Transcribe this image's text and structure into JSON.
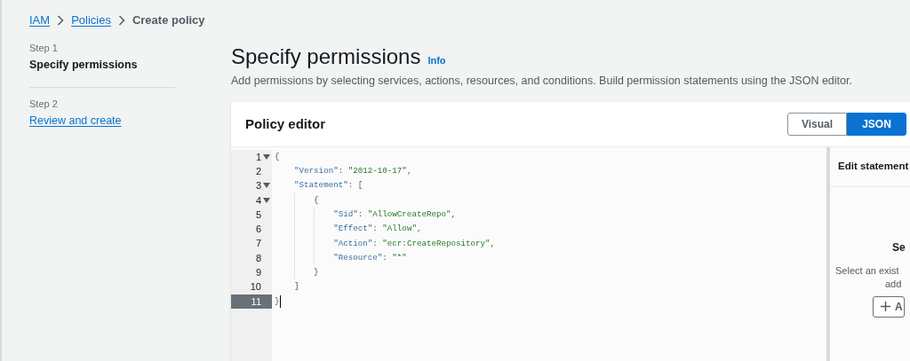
{
  "breadcrumb": [
    {
      "label": "IAM",
      "link": true
    },
    {
      "label": "Policies",
      "link": true
    },
    {
      "label": "Create policy",
      "link": false
    }
  ],
  "steps": [
    {
      "step": "Step 1",
      "title": "Specify permissions",
      "selected": true
    },
    {
      "step": "Step 2",
      "title": "Review and create",
      "selected": false
    }
  ],
  "heading": {
    "title": "Specify permissions",
    "info": "Info",
    "description": "Add permissions by selecting services, actions, resources, and conditions. Build permission statements using the JSON editor."
  },
  "policy_editor": {
    "title": "Policy editor",
    "modes": [
      {
        "label": "Visual",
        "selected": false
      },
      {
        "label": "JSON",
        "selected": true
      }
    ],
    "lines": [
      {
        "number": "1",
        "foldable": true,
        "selected": false,
        "tokens": [
          {
            "kind": "punct",
            "text": "{"
          }
        ]
      },
      {
        "number": "2",
        "foldable": false,
        "selected": false,
        "tokens": [
          {
            "kind": "key",
            "text": "    \"Version\""
          },
          {
            "kind": "punct",
            "text": ": "
          },
          {
            "kind": "string",
            "text": "\"2012-10-17\""
          },
          {
            "kind": "punct",
            "text": ","
          }
        ]
      },
      {
        "number": "3",
        "foldable": true,
        "selected": false,
        "tokens": [
          {
            "kind": "key",
            "text": "    \"Statement\""
          },
          {
            "kind": "punct",
            "text": ": ["
          }
        ]
      },
      {
        "number": "4",
        "foldable": true,
        "selected": false,
        "tokens": [
          {
            "kind": "punct",
            "text": "        {"
          }
        ]
      },
      {
        "number": "5",
        "foldable": false,
        "selected": false,
        "tokens": [
          {
            "kind": "key",
            "text": "            \"Sid\""
          },
          {
            "kind": "punct",
            "text": ": "
          },
          {
            "kind": "string",
            "text": "\"AllowCreateRepo\""
          },
          {
            "kind": "punct",
            "text": ","
          }
        ]
      },
      {
        "number": "6",
        "foldable": false,
        "selected": false,
        "tokens": [
          {
            "kind": "key",
            "text": "            \"Effect\""
          },
          {
            "kind": "punct",
            "text": ": "
          },
          {
            "kind": "string",
            "text": "\"Allow\""
          },
          {
            "kind": "punct",
            "text": ","
          }
        ]
      },
      {
        "number": "7",
        "foldable": false,
        "selected": false,
        "tokens": [
          {
            "kind": "key",
            "text": "            \"Action\""
          },
          {
            "kind": "punct",
            "text": ": "
          },
          {
            "kind": "string",
            "text": "\"ecr:CreateRepository\""
          },
          {
            "kind": "punct",
            "text": ","
          }
        ]
      },
      {
        "number": "8",
        "foldable": false,
        "selected": false,
        "tokens": [
          {
            "kind": "key",
            "text": "            \"Resource\""
          },
          {
            "kind": "punct",
            "text": ": "
          },
          {
            "kind": "string",
            "text": "\"*\""
          }
        ]
      },
      {
        "number": "9",
        "foldable": false,
        "selected": false,
        "tokens": [
          {
            "kind": "punct",
            "text": "        }"
          }
        ]
      },
      {
        "number": "10",
        "foldable": false,
        "selected": false,
        "tokens": [
          {
            "kind": "punct",
            "text": "    ]"
          }
        ]
      },
      {
        "number": "11",
        "foldable": false,
        "selected": true,
        "tokens": [
          {
            "kind": "punct",
            "text": "}"
          }
        ]
      }
    ],
    "side_panel": {
      "title": "Edit statement",
      "empty_title": "Se",
      "empty_lines": [
        "Select an exist",
        "add"
      ],
      "button": "A"
    }
  }
}
